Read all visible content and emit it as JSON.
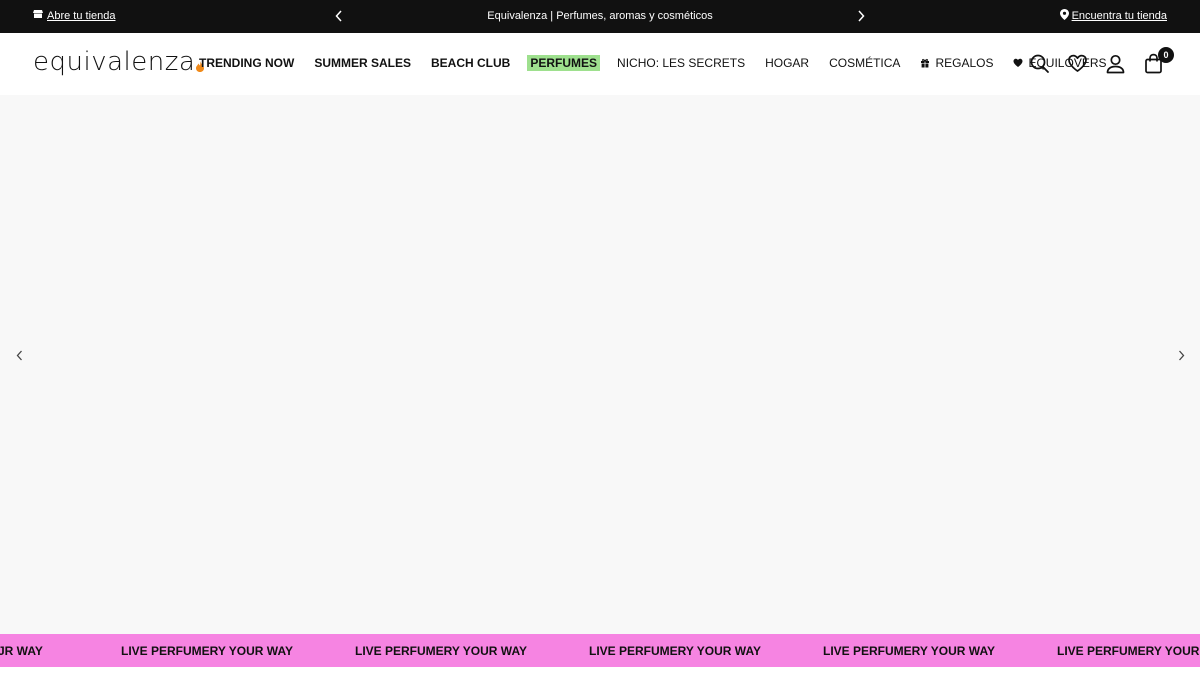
{
  "topbar": {
    "left_link": "Abre tu tienda",
    "left_icon": "store-icon",
    "center_text": "Equivalenza | Perfumes, aromas y cosméticos",
    "right_link": "Encuentra tu tienda",
    "right_icon": "location-pin-icon"
  },
  "header": {
    "logo_text": "equivalenza",
    "nav": [
      {
        "label": "TRENDING NOW"
      },
      {
        "label": "SUMMER SALES"
      },
      {
        "label": "BEACH CLUB"
      },
      {
        "label": "PERFUMES"
      },
      {
        "label": "NICHO: LES SECRETS"
      },
      {
        "label": "HOGAR"
      },
      {
        "label": "COSMÉTICA"
      },
      {
        "label": "REGALOS",
        "icon": "gift-icon"
      },
      {
        "label": "EQUILOVERS",
        "icon": "heart-icon"
      }
    ],
    "cart_count": "0",
    "highlight_color": "#9ee08e"
  },
  "marquee": {
    "text": "LIVE PERFUMERY YOUR WAY",
    "partial_left": "JR WAY",
    "partial_right": "LIVE PERFUMERY YOUR WAY",
    "background": "#f684e2"
  },
  "colors": {
    "topbar_bg": "#111111",
    "hero_bg": "#f8f8f8"
  }
}
